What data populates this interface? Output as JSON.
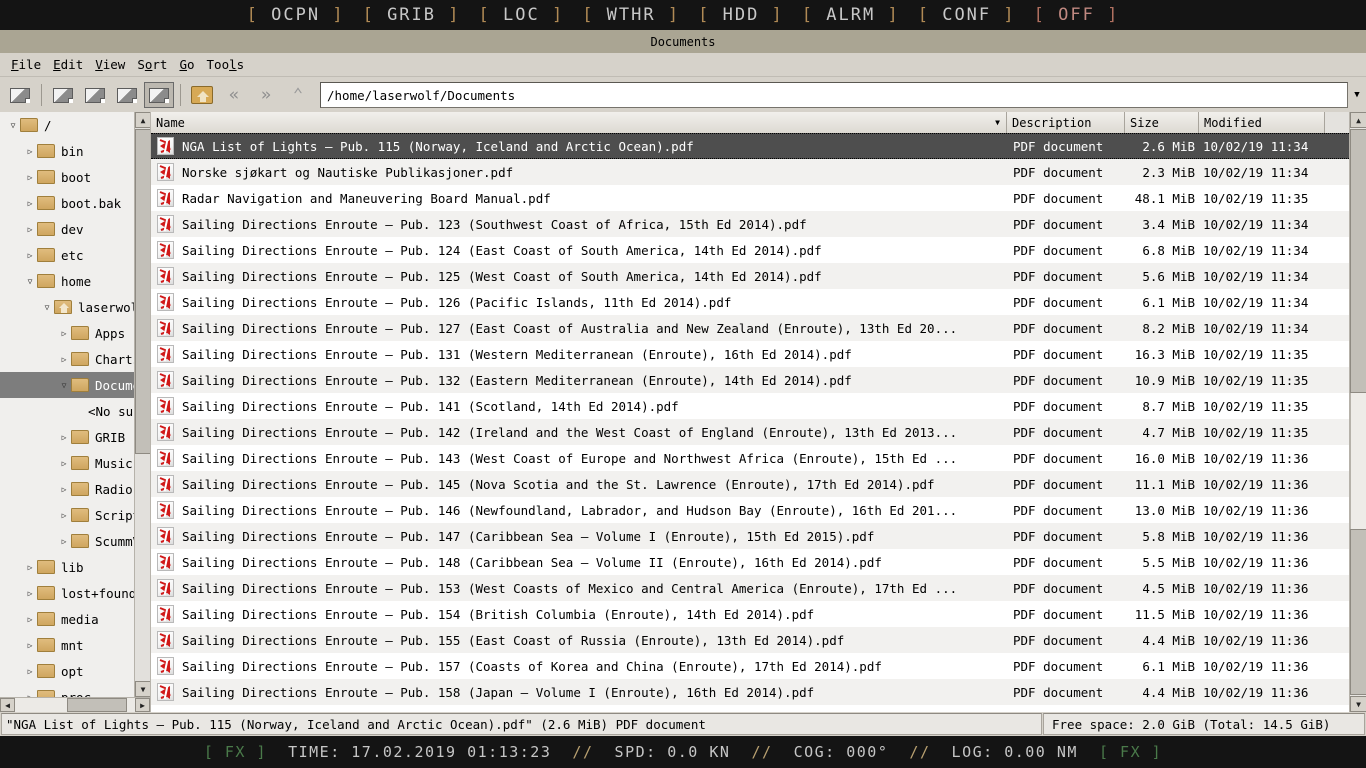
{
  "topnav": {
    "items": [
      {
        "label": "OCPN",
        "state": "normal"
      },
      {
        "label": "GRIB",
        "state": "normal"
      },
      {
        "label": "LOC",
        "state": "normal"
      },
      {
        "label": "WTHR",
        "state": "normal"
      },
      {
        "label": "HDD",
        "state": "normal"
      },
      {
        "label": "ALRM",
        "state": "normal"
      },
      {
        "label": "CONF",
        "state": "normal"
      },
      {
        "label": "OFF",
        "state": "off"
      }
    ],
    "bracket_open": "[",
    "bracket_close": "]",
    "bracket_color": "#b08a55",
    "label_color": "#c8c8c8",
    "off_color": "#c08880",
    "background": "#141414"
  },
  "window": {
    "title": "Documents",
    "titlebar_color": "#aaa593"
  },
  "menubar": {
    "items": [
      {
        "pre": "",
        "mnemonic": "F",
        "post": "ile"
      },
      {
        "pre": "",
        "mnemonic": "E",
        "post": "dit"
      },
      {
        "pre": "",
        "mnemonic": "V",
        "post": "iew"
      },
      {
        "pre": "S",
        "mnemonic": "o",
        "post": "rt"
      },
      {
        "pre": "",
        "mnemonic": "G",
        "post": "o"
      },
      {
        "pre": "Too",
        "mnemonic": "l",
        "post": "s"
      }
    ]
  },
  "toolbar": {
    "view_buttons": [
      {
        "name": "view-mode-1",
        "active": false
      },
      {
        "name": "view-mode-2",
        "active": false
      },
      {
        "name": "view-mode-3",
        "active": false
      },
      {
        "name": "view-mode-4",
        "active": false
      },
      {
        "name": "view-mode-5",
        "active": true
      }
    ],
    "home_title": "Home",
    "back_glyph": "«",
    "forward_glyph": "»",
    "up_glyph": "⌃",
    "path": "/home/laserwolf/Documents",
    "path_placeholder": "/home/laserwolf/Documents",
    "dropdown_glyph": "▼"
  },
  "tree": {
    "items": [
      {
        "label": "/",
        "depth": 0,
        "expander": "▽",
        "icon": "folder-icon",
        "selected": false
      },
      {
        "label": "bin",
        "depth": 1,
        "expander": "▷",
        "icon": "folder-icon",
        "selected": false
      },
      {
        "label": "boot",
        "depth": 1,
        "expander": "▷",
        "icon": "folder-icon",
        "selected": false
      },
      {
        "label": "boot.bak",
        "depth": 1,
        "expander": "▷",
        "icon": "folder-icon",
        "selected": false
      },
      {
        "label": "dev",
        "depth": 1,
        "expander": "▷",
        "icon": "folder-icon",
        "selected": false
      },
      {
        "label": "etc",
        "depth": 1,
        "expander": "▷",
        "icon": "folder-icon",
        "selected": false
      },
      {
        "label": "home",
        "depth": 1,
        "expander": "▽",
        "icon": "folder-icon",
        "selected": false
      },
      {
        "label": "laserwolf",
        "depth": 2,
        "expander": "▽",
        "icon": "home-folder-icon",
        "selected": false
      },
      {
        "label": "Apps",
        "depth": 3,
        "expander": "▷",
        "icon": "folder-icon",
        "selected": false
      },
      {
        "label": "Charts",
        "depth": 3,
        "expander": "▷",
        "icon": "folder-icon",
        "selected": false
      },
      {
        "label": "Documents",
        "depth": 3,
        "expander": "▽",
        "icon": "folder-icon",
        "selected": true
      },
      {
        "label": "<No subfolders>",
        "depth": 4,
        "expander": "",
        "icon": "none",
        "selected": false
      },
      {
        "label": "GRIB",
        "depth": 3,
        "expander": "▷",
        "icon": "folder-icon",
        "selected": false
      },
      {
        "label": "Music",
        "depth": 3,
        "expander": "▷",
        "icon": "folder-icon",
        "selected": false
      },
      {
        "label": "Radio",
        "depth": 3,
        "expander": "▷",
        "icon": "folder-icon",
        "selected": false
      },
      {
        "label": "Scripts",
        "depth": 3,
        "expander": "▷",
        "icon": "folder-icon",
        "selected": false
      },
      {
        "label": "ScummVM",
        "depth": 3,
        "expander": "▷",
        "icon": "folder-icon",
        "selected": false
      },
      {
        "label": "lib",
        "depth": 1,
        "expander": "▷",
        "icon": "folder-icon",
        "selected": false
      },
      {
        "label": "lost+found",
        "depth": 1,
        "expander": "▷",
        "icon": "folder-icon",
        "selected": false
      },
      {
        "label": "media",
        "depth": 1,
        "expander": "▷",
        "icon": "folder-icon",
        "selected": false
      },
      {
        "label": "mnt",
        "depth": 1,
        "expander": "▷",
        "icon": "folder-icon",
        "selected": false
      },
      {
        "label": "opt",
        "depth": 1,
        "expander": "▷",
        "icon": "folder-icon",
        "selected": false
      },
      {
        "label": "proc",
        "depth": 1,
        "expander": "▷",
        "icon": "folder-icon",
        "selected": false
      }
    ]
  },
  "filelist": {
    "columns": [
      {
        "label": "Name",
        "key": "name",
        "sorted": true
      },
      {
        "label": "Description",
        "key": "desc",
        "sorted": false
      },
      {
        "label": "Size",
        "key": "size",
        "sorted": false
      },
      {
        "label": "Modified",
        "key": "mod",
        "sorted": false
      }
    ],
    "sort_glyph": "▼",
    "rows": [
      {
        "name": "NGA List of Lights – Pub. 115 (Norway, Iceland and Arctic Ocean).pdf",
        "desc": "PDF document",
        "size": "2.6 MiB",
        "mod": "10/02/19 11:34",
        "selected": true
      },
      {
        "name": "Norske sjøkart og Nautiske Publikasjoner.pdf",
        "desc": "PDF document",
        "size": "2.3 MiB",
        "mod": "10/02/19 11:34",
        "selected": false
      },
      {
        "name": "Radar Navigation and Maneuvering Board Manual.pdf",
        "desc": "PDF document",
        "size": "48.1 MiB",
        "mod": "10/02/19 11:35",
        "selected": false
      },
      {
        "name": "Sailing Directions Enroute – Pub. 123 (Southwest Coast of Africa, 15th Ed 2014).pdf",
        "desc": "PDF document",
        "size": "3.4 MiB",
        "mod": "10/02/19 11:34",
        "selected": false
      },
      {
        "name": "Sailing Directions Enroute – Pub. 124 (East Coast of South America, 14th Ed 2014).pdf",
        "desc": "PDF document",
        "size": "6.8 MiB",
        "mod": "10/02/19 11:34",
        "selected": false
      },
      {
        "name": "Sailing Directions Enroute – Pub. 125 (West Coast of South America, 14th Ed 2014).pdf",
        "desc": "PDF document",
        "size": "5.6 MiB",
        "mod": "10/02/19 11:34",
        "selected": false
      },
      {
        "name": "Sailing Directions Enroute – Pub. 126 (Pacific Islands, 11th Ed 2014).pdf",
        "desc": "PDF document",
        "size": "6.1 MiB",
        "mod": "10/02/19 11:34",
        "selected": false
      },
      {
        "name": "Sailing Directions Enroute – Pub. 127 (East Coast of Australia and New Zealand (Enroute), 13th Ed 20...",
        "desc": "PDF document",
        "size": "8.2 MiB",
        "mod": "10/02/19 11:34",
        "selected": false
      },
      {
        "name": "Sailing Directions Enroute – Pub. 131 (Western Mediterranean (Enroute), 16th Ed 2014).pdf",
        "desc": "PDF document",
        "size": "16.3 MiB",
        "mod": "10/02/19 11:35",
        "selected": false
      },
      {
        "name": "Sailing Directions Enroute – Pub. 132 (Eastern Mediterranean (Enroute), 14th Ed 2014).pdf",
        "desc": "PDF document",
        "size": "10.9 MiB",
        "mod": "10/02/19 11:35",
        "selected": false
      },
      {
        "name": "Sailing Directions Enroute – Pub. 141 (Scotland, 14th Ed 2014).pdf",
        "desc": "PDF document",
        "size": "8.7 MiB",
        "mod": "10/02/19 11:35",
        "selected": false
      },
      {
        "name": "Sailing Directions Enroute – Pub. 142 (Ireland and the West Coast of England (Enroute), 13th Ed 2013...",
        "desc": "PDF document",
        "size": "4.7 MiB",
        "mod": "10/02/19 11:35",
        "selected": false
      },
      {
        "name": "Sailing Directions Enroute – Pub. 143 (West Coast of Europe and Northwest Africa (Enroute), 15th Ed ...",
        "desc": "PDF document",
        "size": "16.0 MiB",
        "mod": "10/02/19 11:36",
        "selected": false
      },
      {
        "name": "Sailing Directions Enroute – Pub. 145 (Nova Scotia and the St. Lawrence (Enroute), 17th Ed 2014).pdf",
        "desc": "PDF document",
        "size": "11.1 MiB",
        "mod": "10/02/19 11:36",
        "selected": false
      },
      {
        "name": "Sailing Directions Enroute – Pub. 146 (Newfoundland, Labrador, and Hudson Bay (Enroute), 16th Ed 201...",
        "desc": "PDF document",
        "size": "13.0 MiB",
        "mod": "10/02/19 11:36",
        "selected": false
      },
      {
        "name": "Sailing Directions Enroute – Pub. 147 (Caribbean Sea – Volume I (Enroute), 15th Ed 2015).pdf",
        "desc": "PDF document",
        "size": "5.8 MiB",
        "mod": "10/02/19 11:36",
        "selected": false
      },
      {
        "name": "Sailing Directions Enroute – Pub. 148 (Caribbean Sea – Volume II (Enroute), 16th Ed 2014).pdf",
        "desc": "PDF document",
        "size": "5.5 MiB",
        "mod": "10/02/19 11:36",
        "selected": false
      },
      {
        "name": "Sailing Directions Enroute – Pub. 153 (West Coasts of Mexico and Central America (Enroute), 17th Ed ...",
        "desc": "PDF document",
        "size": "4.5 MiB",
        "mod": "10/02/19 11:36",
        "selected": false
      },
      {
        "name": "Sailing Directions Enroute – Pub. 154 (British Columbia (Enroute), 14th Ed 2014).pdf",
        "desc": "PDF document",
        "size": "11.5 MiB",
        "mod": "10/02/19 11:36",
        "selected": false
      },
      {
        "name": "Sailing Directions Enroute – Pub. 155 (East Coast of Russia (Enroute), 13th Ed 2014).pdf",
        "desc": "PDF document",
        "size": "4.4 MiB",
        "mod": "10/02/19 11:36",
        "selected": false
      },
      {
        "name": "Sailing Directions Enroute – Pub. 157 (Coasts of Korea and China (Enroute), 17th Ed 2014).pdf",
        "desc": "PDF document",
        "size": "6.1 MiB",
        "mod": "10/02/19 11:36",
        "selected": false
      },
      {
        "name": "Sailing Directions Enroute – Pub. 158 (Japan – Volume I (Enroute), 16th Ed 2014).pdf",
        "desc": "PDF document",
        "size": "4.4 MiB",
        "mod": "10/02/19 11:36",
        "selected": false
      }
    ]
  },
  "statusbar": {
    "left": "\"NGA List of Lights – Pub. 115 (Norway, Iceland and Arctic Ocean).pdf\" (2.6 MiB) PDF document",
    "right": "Free space: 2.0 GiB (Total: 14.5 GiB)"
  },
  "bottombar": {
    "fx_left": "[ FX ]",
    "time_label": "TIME:",
    "time_value": "17.02.2019 01:13:23",
    "sep1": "//",
    "spd_label": "SPD:",
    "spd_value": "0.0 KN",
    "sep2": "//",
    "cog_label": "COG:",
    "cog_value": "000°",
    "sep3": "//",
    "log_label": "LOG:",
    "log_value": "0.00 NM",
    "fx_right": "[ FX ]",
    "fx_color": "#4a7a4a",
    "text_color": "#c6c6c6"
  }
}
